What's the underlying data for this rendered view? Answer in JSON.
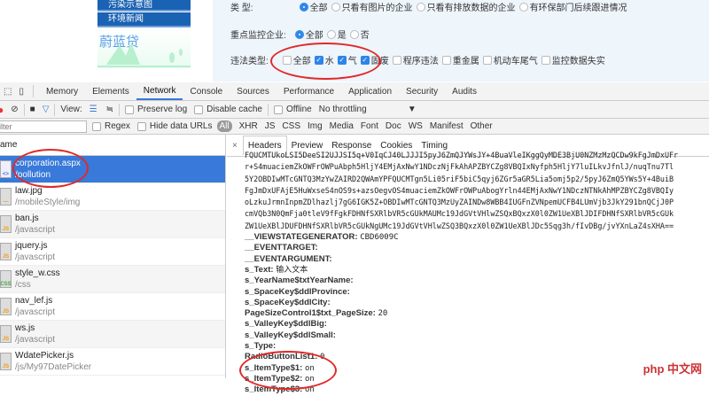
{
  "sidebar": {
    "items": [
      "污染示意图",
      "环境新闻"
    ],
    "logo": "蔚蓝贷"
  },
  "form": {
    "type": {
      "label": "类 型:",
      "options": [
        "全部",
        "只看有图片的企业",
        "只看有排放数据的企业",
        "有环保部门后续跟进情况"
      ],
      "selected": 0
    },
    "key_monitor": {
      "label": "重点监控企业:",
      "options": [
        "全部",
        "是",
        "否"
      ],
      "selected": 0
    },
    "violation": {
      "label": "违法类型:",
      "options": [
        {
          "label": "全部",
          "checked": false
        },
        {
          "label": "水",
          "checked": true
        },
        {
          "label": "气",
          "checked": true
        },
        {
          "label": "固废",
          "checked": true
        },
        {
          "label": "程序违法",
          "checked": false
        },
        {
          "label": "重金属",
          "checked": false
        },
        {
          "label": "机动车尾气",
          "checked": false
        },
        {
          "label": "监控数据失实",
          "checked": false
        }
      ]
    }
  },
  "devtools": {
    "tabs": [
      "Memory",
      "Elements",
      "Network",
      "Console",
      "Sources",
      "Performance",
      "Application",
      "Security",
      "Audits"
    ],
    "active_tab": "Network",
    "toolbar": {
      "view_label": "View:",
      "preserve_log": "Preserve log",
      "disable_cache": "Disable cache",
      "offline": "Offline",
      "throttling": "No throttling"
    },
    "filter": {
      "placeholder": "ilter",
      "regex": "Regex",
      "hide_data_urls": "Hide data URLs",
      "types": [
        "All",
        "XHR",
        "JS",
        "CSS",
        "Img",
        "Media",
        "Font",
        "Doc",
        "WS",
        "Manifest",
        "Other"
      ]
    },
    "list_header": "ame",
    "requests": [
      {
        "name": "corporation.aspx",
        "path": "/pollution",
        "icon": "<>"
      },
      {
        "name": "law.jpg",
        "path": "/mobileStyle/img",
        "icon": "—"
      },
      {
        "name": "ban.js",
        "path": "/javascript",
        "icon": "JS"
      },
      {
        "name": "jquery.js",
        "path": "/javascript",
        "icon": "JS"
      },
      {
        "name": "style_w.css",
        "path": "/css",
        "icon": "CSS"
      },
      {
        "name": "nav_lef.js",
        "path": "/javascript",
        "icon": "JS"
      },
      {
        "name": "ws.js",
        "path": "/javascript",
        "icon": "JS"
      },
      {
        "name": "WdatePicker.js",
        "path": "/js/My97DatePicker",
        "icon": "JS"
      }
    ],
    "detail_tabs": [
      "Headers",
      "Preview",
      "Response",
      "Cookies",
      "Timing"
    ],
    "close": "×",
    "viewstate_lines": [
      "FQUCMTUkoLSI5DeeSI2UJJSI5q+V0IqCJ40LJJJI5pyJ6ZmQJYWsJY+4BuaVleIKggQyMDE3BjU0NZMzMzQCDw9kFgJmDxUFr",
      "r+S4muaciemZkOWFrOWPuAbph5HljY4EMjAxNwY1NDczNjFkAhAPZBYCZg8VBQIxNyfph5HljY7luILkvJfnlJ/nuqTnu7Tl",
      "5Y2OBDIwMTcGNTQ3MzYwZAIRD2QWAmYPFQUCMTgn5Li05riF5biC5qyj6ZGr5aGR5Lia5omj5p2/5pyJ6ZmQ5YWs5Y+4BuiB",
      "FgJmDxUFAjE5HuWxseS4nOS9s+azsOegvOS4muaciemZkOWFrOWPuAbogYrln44EMjAxNwY1NDczNTNkAhMPZBYCZg8VBQIy",
      "oLzkuJrmnInpmZDlhazlj7gG6IGK5Z+OBDIwMTcGNTQ3MzUyZAINDw8WBB4IUGFnZVNpemUCFB4LUmVjb3JkY291bnQCjJ0P",
      "cmVQb3N0QmFja0tleV9fFgkFDHNfSXRlbVR5cGUkMAUMc19JdGVtVHlwZSQxBQxzX0l0ZW1UeXBlJDIFDHNfSXRlbVR5cGUk",
      "ZW1UeXBlJDUFDHNfSXRlbVR5cGUkNgUMc19JdGVtVHlwZSQ3BQxzX0l0ZW1UeXBlJDc5Sqg3h/fIvDBg/jvYXnLaZ4sXHA=="
    ],
    "form_fields": [
      {
        "k": "__VIEWSTATEGENERATOR:",
        "v": "CBD6009C"
      },
      {
        "k": "__EVENTTARGET:",
        "v": ""
      },
      {
        "k": "__EVENTARGUMENT:",
        "v": ""
      },
      {
        "k": "s_Text:",
        "v": "输入文本"
      },
      {
        "k": "s_YearName$txtYearName:",
        "v": ""
      },
      {
        "k": "s_SpaceKey$ddlProvince:",
        "v": ""
      },
      {
        "k": "s_SpaceKey$ddlCity:",
        "v": ""
      },
      {
        "k": "PageSizeControl1$txt_PageSize:",
        "v": "20"
      },
      {
        "k": "s_ValleyKey$ddlBig:",
        "v": ""
      },
      {
        "k": "s_ValleyKey$ddlSmall:",
        "v": ""
      },
      {
        "k": "s_Type:",
        "v": ""
      },
      {
        "k": "RadioButtonList1:",
        "v": "0"
      },
      {
        "k": "s_ItemType$1:",
        "v": "on"
      },
      {
        "k": "s_ItemType$2:",
        "v": "on"
      },
      {
        "k": "s_ItemType$3:",
        "v": "on"
      }
    ]
  },
  "watermark": "php 中文网",
  "colors": {
    "accent": "#3879d9",
    "nav": "#1a62b3",
    "annotation": "#e02a2a"
  }
}
